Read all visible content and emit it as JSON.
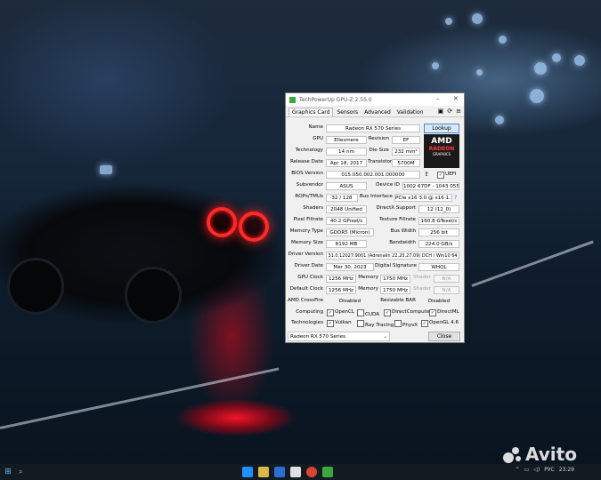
{
  "window": {
    "title": "TechPowerUp GPU-Z 2.55.0",
    "tabs": [
      "Graphics Card",
      "Sensors",
      "Advanced",
      "Validation"
    ],
    "lookup_label": "Lookup",
    "uefi_label": "UEFI",
    "gpu_select_value": "Radeon RX 570 Series",
    "close_label": "Close",
    "brand_logo": {
      "line1": "AMD",
      "line2": "RADEON",
      "line3": "GRAPHICS"
    }
  },
  "fields": {
    "name": {
      "label": "Name",
      "value": "Radeon RX 570 Series"
    },
    "gpu": {
      "label": "GPU",
      "value": "Ellesmere"
    },
    "revision": {
      "label": "Revision",
      "value": "EF"
    },
    "technology": {
      "label": "Technology",
      "value": "14 nm"
    },
    "die_size": {
      "label": "Die Size",
      "value": "232 mm²"
    },
    "release_date": {
      "label": "Release Date",
      "value": "Apr 18, 2017"
    },
    "transistors": {
      "label": "Transistors",
      "value": "5700M"
    },
    "bios_version": {
      "label": "BIOS Version",
      "value": "015.050.002.001.000000"
    },
    "subvendor": {
      "label": "Subvendor",
      "value": "ASUS"
    },
    "device_id": {
      "label": "Device ID",
      "value": "1002 67DF - 1043 0558"
    },
    "rops_tmus": {
      "label": "ROPs/TMUs",
      "value": "32 / 128"
    },
    "bus_interface": {
      "label": "Bus Interface",
      "value": "PCIe x16 3.0 @ x16 1.1"
    },
    "shaders": {
      "label": "Shaders",
      "value": "2048 Unified"
    },
    "directx_support": {
      "label": "DirectX Support",
      "value": "12 (12_0)"
    },
    "pixel_fillrate": {
      "label": "Pixel Fillrate",
      "value": "40.2 GPixel/s"
    },
    "texture_fillrate": {
      "label": "Texture Fillrate",
      "value": "160.8 GTexel/s"
    },
    "memory_type": {
      "label": "Memory Type",
      "value": "GDDR5 (Micron)"
    },
    "bus_width": {
      "label": "Bus Width",
      "value": "256 bit"
    },
    "memory_size": {
      "label": "Memory Size",
      "value": "8192 MB"
    },
    "bandwidth": {
      "label": "Bandwidth",
      "value": "224.0 GB/s"
    },
    "driver_version": {
      "label": "Driver Version",
      "value": "31.0.12027.9001 (Adrenalin 22.20.27.09) DCH / Win10 64"
    },
    "driver_date": {
      "label": "Driver Date",
      "value": "Mar 30, 2023"
    },
    "digital_signature": {
      "label": "Digital Signature",
      "value": "WHQL"
    },
    "gpu_clock": {
      "label": "GPU Clock",
      "value": "1256 MHz",
      "memory_label": "Memory",
      "memory_value": "1750 MHz",
      "shader_label": "Shader",
      "shader_value": "N/A"
    },
    "default_clock": {
      "label": "Default Clock",
      "value": "1256 MHz",
      "memory_label": "Memory",
      "memory_value": "1750 MHz",
      "shader_label": "Shader",
      "shader_value": "N/A"
    },
    "crossfire": {
      "label": "AMD CrossFire",
      "value": "Disabled"
    },
    "resizable_bar": {
      "label": "Resizable BAR",
      "value": "Disabled"
    },
    "computing": {
      "label": "Computing",
      "items": [
        "OpenCL",
        "CUDA",
        "DirectCompute",
        "DirectML"
      ]
    },
    "technologies": {
      "label": "Technologies",
      "items": [
        "Vulkan",
        "Ray Tracing",
        "PhysX",
        "OpenGL 4.6"
      ]
    }
  },
  "taskbar": {
    "tray_lang": "РУС",
    "time": "23:29",
    "watermark": "Avito"
  }
}
